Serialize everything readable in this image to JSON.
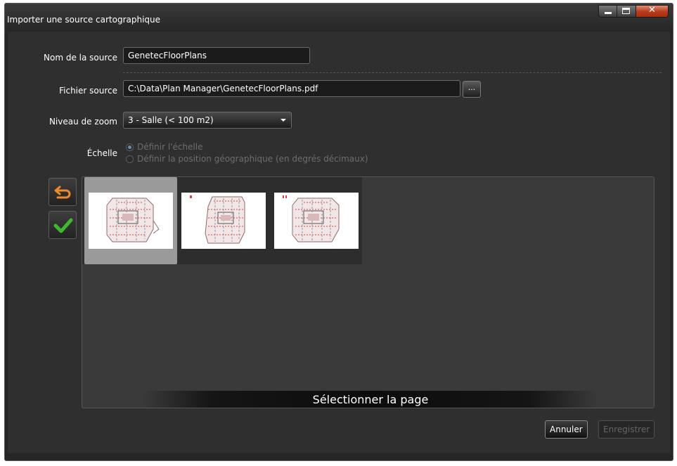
{
  "window": {
    "title": "Importer une source cartographique"
  },
  "form": {
    "source_name": {
      "label": "Nom de la source",
      "value": "GenetecFloorPlans"
    },
    "source_file": {
      "label": "Fichier source",
      "value": "C:\\Data\\Plan Manager\\GenetecFloorPlans.pdf",
      "browse_label": "..."
    },
    "zoom_level": {
      "label": "Niveau de zoom",
      "value": "3 - Salle (< 100 m2)"
    },
    "scale": {
      "label": "Échelle",
      "options": [
        {
          "label": "Définir l'échelle",
          "checked": true
        },
        {
          "label": "Définir la position géographique (en degrés décimaux)",
          "checked": false
        }
      ]
    }
  },
  "sidebar_buttons": {
    "back_icon": "undo-arrow-icon",
    "confirm_icon": "checkmark-icon"
  },
  "pages": {
    "caption": "Sélectionner la page",
    "count": 3,
    "selected_index": 0
  },
  "footer": {
    "cancel_label": "Annuler",
    "save_label": "Enregistrer",
    "save_enabled": false
  },
  "colors": {
    "background": "#2f2f2f",
    "accent_orange": "#e8792a",
    "accent_green": "#3fb82f",
    "close_red": "#b83a1c"
  }
}
